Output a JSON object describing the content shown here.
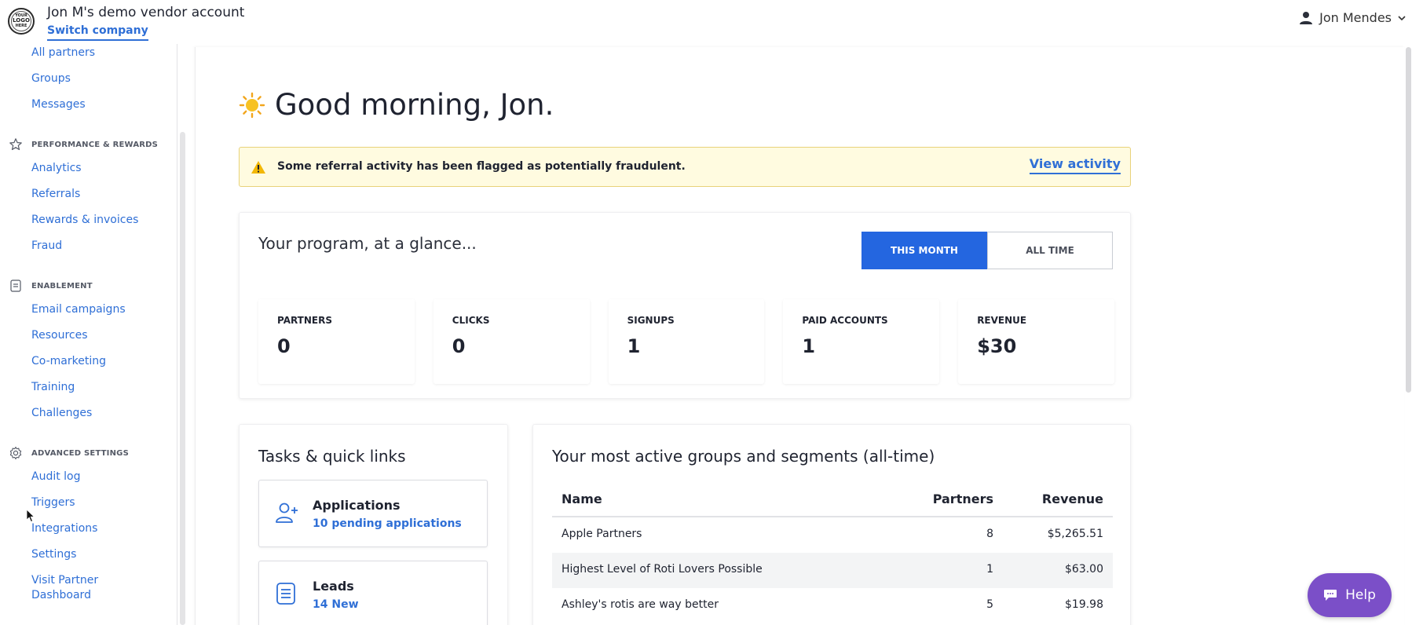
{
  "header": {
    "logo_text_top": "YOUR",
    "logo_text_mid": "LOGO",
    "logo_text_bottom": "HERE",
    "company_name": "Jon M's demo vendor account",
    "switch_company": "Switch company",
    "user_name": "Jon Mendes"
  },
  "sidebar": {
    "top_links": [
      "All partners",
      "Groups",
      "Messages"
    ],
    "sections": [
      {
        "heading": "PERFORMANCE & REWARDS",
        "icon": "star-icon",
        "links": [
          "Analytics",
          "Referrals",
          "Rewards & invoices",
          "Fraud"
        ]
      },
      {
        "heading": "ENABLEMENT",
        "icon": "document-icon",
        "links": [
          "Email campaigns",
          "Resources",
          "Co-marketing",
          "Training",
          "Challenges"
        ]
      },
      {
        "heading": "ADVANCED SETTINGS",
        "icon": "gear-icon",
        "links": [
          "Audit log",
          "Triggers",
          "Integrations",
          "Settings",
          "Visit Partner",
          "Dashboard"
        ]
      }
    ]
  },
  "main": {
    "greeting": "Good morning, Jon.",
    "alert": {
      "text": "Some referral activity has been flagged as potentially fraudulent.",
      "link": "View activity",
      "background": "#fffbe0"
    },
    "glance": {
      "title": "Your program, at a glance...",
      "toggle": [
        "THIS MONTH",
        "ALL TIME"
      ],
      "active_toggle": "THIS MONTH",
      "stats": [
        {
          "label": "PARTNERS",
          "value": "0"
        },
        {
          "label": "CLICKS",
          "value": "0"
        },
        {
          "label": "SIGNUPS",
          "value": "1"
        },
        {
          "label": "PAID ACCOUNTS",
          "value": "1"
        },
        {
          "label": "REVENUE",
          "value": "$30"
        }
      ]
    },
    "tasks": {
      "title": "Tasks & quick links",
      "items": [
        {
          "title": "Applications",
          "subtitle": "10 pending applications",
          "icon": "add-user-icon"
        },
        {
          "title": "Leads",
          "subtitle": "14 New",
          "icon": "list-document-icon"
        }
      ]
    },
    "groups": {
      "title": "Your most active groups and segments (all-time)",
      "columns": [
        "Name",
        "Partners",
        "Revenue"
      ],
      "rows": [
        [
          "Apple Partners",
          "8",
          "$5,265.51"
        ],
        [
          "Highest Level of Roti Lovers Possible",
          "1",
          "$63.00"
        ],
        [
          "Ashley's rotis are way better",
          "5",
          "$19.98"
        ]
      ]
    }
  },
  "help_button": "Help",
  "colors": {
    "accent": "#2466e0",
    "link": "#2f6fd6",
    "help": "#7b4fc8"
  }
}
